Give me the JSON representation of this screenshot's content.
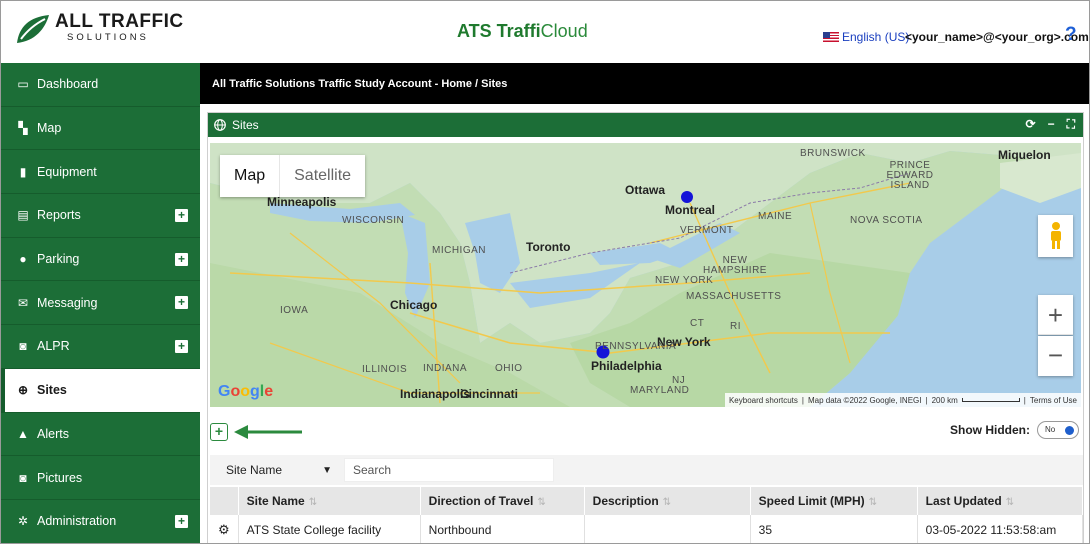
{
  "header": {
    "logo_line1": "ALL TRAFFIC",
    "logo_line2": "SOLUTIONS",
    "app_title_bold": "ATS Traffi",
    "app_title_light": "Cloud",
    "language": "English (US)",
    "user": "<your_name>@<your_org>.com",
    "help": "?"
  },
  "sidebar": {
    "items": [
      {
        "label": "Dashboard",
        "icon": "laptop-icon",
        "expandable": false
      },
      {
        "label": "Map",
        "icon": "map-icon",
        "expandable": false
      },
      {
        "label": "Equipment",
        "icon": "traffic-light-icon",
        "expandable": false
      },
      {
        "label": "Reports",
        "icon": "report-icon",
        "expandable": true
      },
      {
        "label": "Parking",
        "icon": "parking-icon",
        "expandable": true
      },
      {
        "label": "Messaging",
        "icon": "envelope-icon",
        "expandable": true
      },
      {
        "label": "ALPR",
        "icon": "camera-icon",
        "expandable": true
      },
      {
        "label": "Sites",
        "icon": "globe-icon",
        "expandable": false,
        "active": true
      },
      {
        "label": "Alerts",
        "icon": "warning-icon",
        "expandable": false
      },
      {
        "label": "Pictures",
        "icon": "camera-icon",
        "expandable": false
      },
      {
        "label": "Administration",
        "icon": "cog-icon",
        "expandable": true
      }
    ]
  },
  "breadcrumb": "All Traffic Solutions Traffic Study Account - Home /  Sites",
  "panel": {
    "title": "Sites",
    "tools": [
      "refresh",
      "minimize",
      "fullscreen"
    ]
  },
  "map": {
    "toggle": [
      "Map",
      "Satellite"
    ],
    "labels": [
      {
        "text": "Minneapolis",
        "kind": "city"
      },
      {
        "text": "WISCONSIN",
        "kind": "state"
      },
      {
        "text": "MICHIGAN",
        "kind": "state"
      },
      {
        "text": "Toronto",
        "kind": "city"
      },
      {
        "text": "Ottawa",
        "kind": "city"
      },
      {
        "text": "Montreal",
        "kind": "city"
      },
      {
        "text": "MAINE",
        "kind": "state"
      },
      {
        "text": "VERMONT",
        "kind": "state"
      },
      {
        "text": "NEW YORK",
        "kind": "state"
      },
      {
        "text": "NEW HAMPSHIRE",
        "kind": "state"
      },
      {
        "text": "MASSACHUSETTS",
        "kind": "state"
      },
      {
        "text": "CT",
        "kind": "state"
      },
      {
        "text": "RI",
        "kind": "state"
      },
      {
        "text": "New York",
        "kind": "city"
      },
      {
        "text": "PENNSYLVANIA",
        "kind": "state"
      },
      {
        "text": "Philadelphia",
        "kind": "city"
      },
      {
        "text": "NJ",
        "kind": "state"
      },
      {
        "text": "MARYLAND",
        "kind": "state"
      },
      {
        "text": "OHIO",
        "kind": "state"
      },
      {
        "text": "INDIANA",
        "kind": "state"
      },
      {
        "text": "ILLINOIS",
        "kind": "state"
      },
      {
        "text": "IOWA",
        "kind": "state"
      },
      {
        "text": "Chicago",
        "kind": "city"
      },
      {
        "text": "Indianapolis",
        "kind": "city"
      },
      {
        "text": "Cincinnati",
        "kind": "city"
      },
      {
        "text": "BRUNSWICK",
        "kind": "state"
      },
      {
        "text": "PRINCE EDWARD ISLAND",
        "kind": "state"
      },
      {
        "text": "NOVA SCOTIA",
        "kind": "state"
      },
      {
        "text": "Miquelon",
        "kind": "city"
      }
    ],
    "google": "Google",
    "footer": [
      "Keyboard shortcuts",
      "Map data ©2022 Google, INEGI",
      "200 km",
      "Terms of Use"
    ],
    "zoom_in": "+",
    "zoom_out": "−"
  },
  "controls": {
    "add": "+",
    "show_hidden_label": "Show Hidden:",
    "show_hidden_value": "No"
  },
  "filter": {
    "field": "Site Name",
    "placeholder": "Search"
  },
  "table": {
    "columns": [
      "Site Name",
      "Direction of Travel",
      "Description",
      "Speed Limit (MPH)",
      "Last Updated"
    ],
    "rows": [
      [
        "ATS State College facility",
        "Northbound",
        "",
        "35",
        "03-05-2022 11:53:58:am"
      ]
    ]
  },
  "colors": {
    "brand_green": "#1c6e37",
    "marker_blue": "#1414d8",
    "arrow_green": "#2b8a3e"
  }
}
